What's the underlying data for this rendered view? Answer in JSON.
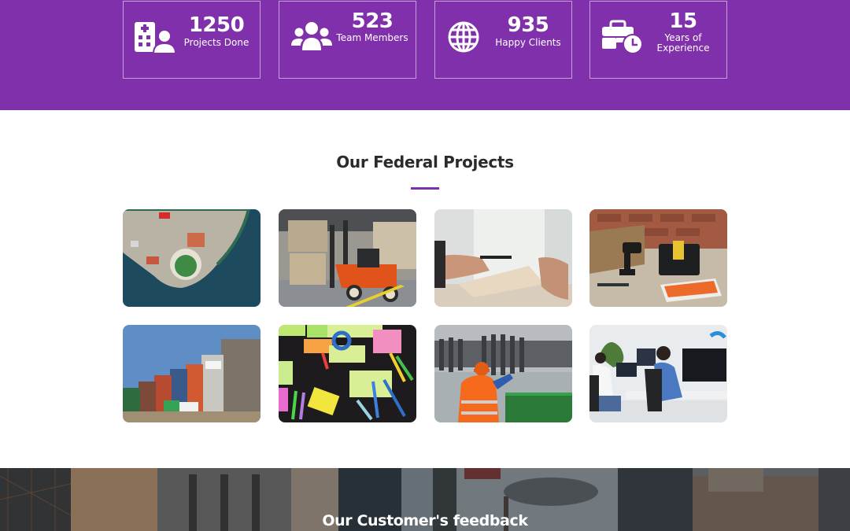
{
  "stats": {
    "band_color": "#8030ab",
    "items": [
      {
        "icon": "hospital-user-icon",
        "value": "1250",
        "label": "Projects Done"
      },
      {
        "icon": "users-icon",
        "value": "523",
        "label": "Team Members"
      },
      {
        "icon": "globe-icon",
        "value": "935",
        "label": "Happy Clients"
      },
      {
        "icon": "business-time-icon",
        "value": "15",
        "label": "Years of Experience"
      }
    ]
  },
  "projects": {
    "title": "Our Federal Projects",
    "accent_color": "#8030ab",
    "images": [
      {
        "subject": "aerial view of coastal construction site"
      },
      {
        "subject": "forklift moving boxes in warehouse"
      },
      {
        "subject": "hands exchanging contract document"
      },
      {
        "subject": "power drill and toolbox on workbench"
      },
      {
        "subject": "stacked shipping containers"
      },
      {
        "subject": "sticky notes and markers on desk"
      },
      {
        "subject": "engineer in orange vest with industrial shaft"
      },
      {
        "subject": "developers working at computers in office"
      }
    ]
  },
  "feedback": {
    "title": "Our Customer's feedback"
  }
}
